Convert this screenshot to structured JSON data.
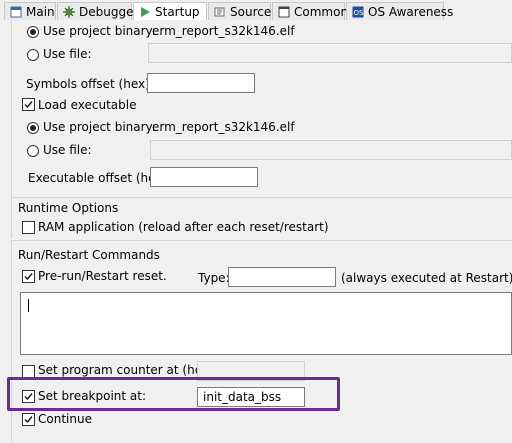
{
  "tabs": [
    {
      "label": "Main",
      "icon": "main-tab-icon"
    },
    {
      "label": "Debugger",
      "icon": "debugger-icon"
    },
    {
      "label": "Startup",
      "icon": "startup-play-icon",
      "active": true
    },
    {
      "label": "Source",
      "icon": "source-icon"
    },
    {
      "label": "Common",
      "icon": "common-icon"
    },
    {
      "label": "OS Awareness",
      "icon": "os-awareness-icon"
    }
  ],
  "symbols": {
    "use_project_binary_label": "Use project binary:",
    "project_binary_value": "erm_report_s32k146.elf",
    "use_file_label": "Use file:",
    "offset_label": "Symbols offset (hex):",
    "offset_value": ""
  },
  "load_executable": {
    "label": "Load executable",
    "use_project_binary_label": "Use project binary:",
    "project_binary_value": "erm_report_s32k146.elf",
    "use_file_label": "Use file:",
    "offset_label": "Executable offset (hex):",
    "offset_value": ""
  },
  "runtime": {
    "title": "Runtime Options",
    "ram_label": "RAM application (reload after each reset/restart)"
  },
  "run_restart": {
    "title": "Run/Restart Commands",
    "prerun_label": "Pre-run/Restart reset.",
    "type_label": "Type:",
    "type_value": "",
    "always_note": "(always executed at Restart)",
    "commands_text": "",
    "set_pc_label": "Set program counter at (hex):",
    "set_pc_value": "",
    "set_bp_label": "Set breakpoint at:",
    "set_bp_value": "init_data_bss",
    "continue_label": "Continue"
  },
  "colors": {
    "highlight": "#6a2c91"
  }
}
